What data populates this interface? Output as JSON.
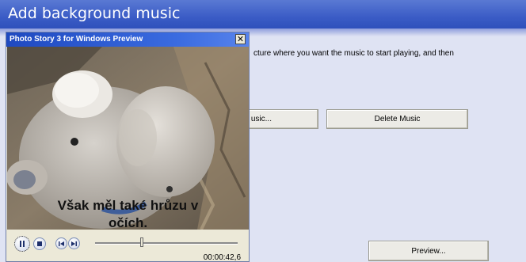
{
  "page": {
    "title": "Add background music",
    "instruction": "cture where you want the music to start playing, and then",
    "buttons": {
      "add_music": "usic...",
      "delete_music": "Delete Music",
      "preview": "Preview..."
    }
  },
  "preview_window": {
    "title": "Photo Story 3 for Windows Preview",
    "close_glyph": "✕",
    "caption_line1": "Však měl také hrůzu v",
    "caption_line2": "očích.",
    "elapsed_time": "00:00:42,6",
    "seek_progress": 0.33
  }
}
